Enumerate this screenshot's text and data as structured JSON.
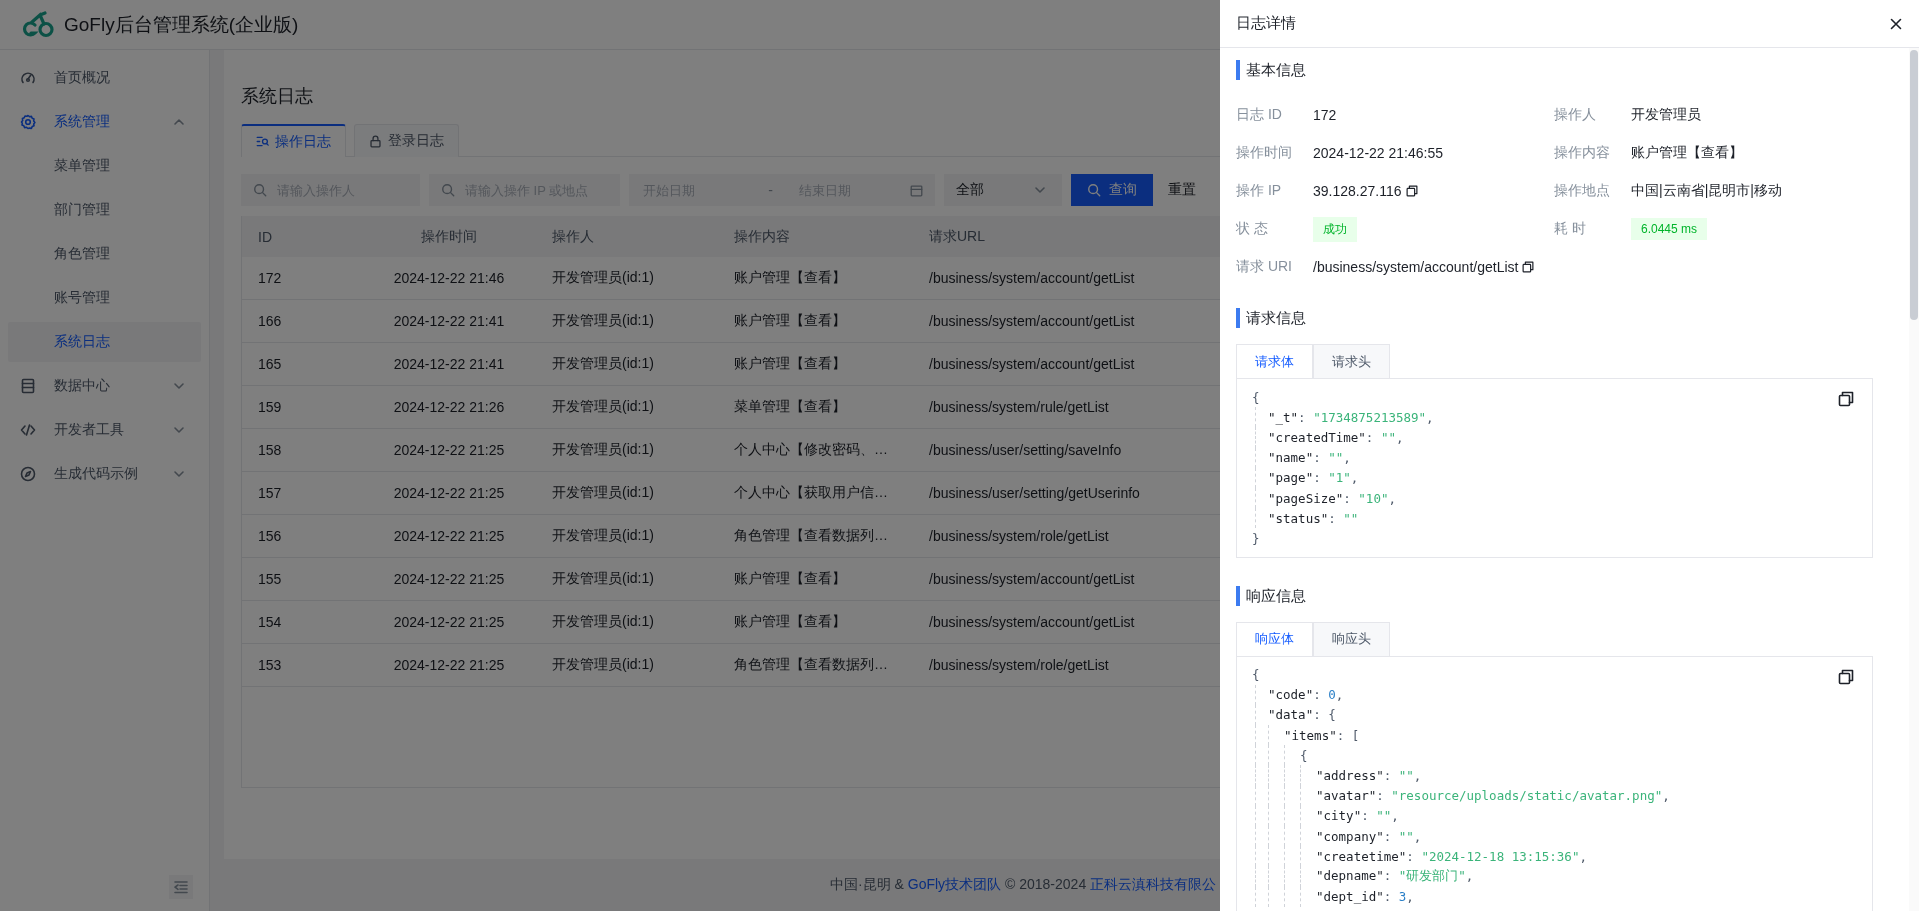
{
  "header": {
    "title": "GoFly后台管理系统(企业版)"
  },
  "sidebar": {
    "items": [
      {
        "label": "首页概况",
        "selected": false
      },
      {
        "label": "系统管理",
        "selected": true,
        "expanded": true,
        "children": [
          {
            "label": "菜单管理",
            "selected": false
          },
          {
            "label": "部门管理",
            "selected": false
          },
          {
            "label": "角色管理",
            "selected": false
          },
          {
            "label": "账号管理",
            "selected": false
          },
          {
            "label": "系统日志",
            "selected": true
          }
        ]
      },
      {
        "label": "数据中心",
        "selected": false,
        "expanded": false
      },
      {
        "label": "开发者工具",
        "selected": false,
        "expanded": false
      },
      {
        "label": "生成代码示例",
        "selected": false,
        "expanded": false
      }
    ]
  },
  "page": {
    "title": "系统日志",
    "tabs": [
      {
        "label": "操作日志",
        "selected": true
      },
      {
        "label": "登录日志",
        "selected": false
      }
    ],
    "filters": [
      {
        "kind": "search",
        "placeholder": "请输入操作人"
      },
      {
        "kind": "search",
        "placeholder": "请输入操作 IP 或地点"
      },
      {
        "kind": "daterange",
        "start_placeholder": "开始日期",
        "separator": "-",
        "end_placeholder": "结束日期"
      },
      {
        "kind": "select",
        "value": "全部"
      }
    ],
    "buttons": [
      {
        "kind": "primary",
        "label": "查询"
      },
      {
        "kind": "plain",
        "label": "重置"
      }
    ],
    "table": {
      "columns": [
        "ID",
        "操作时间",
        "操作人",
        "操作内容",
        "请求URL"
      ],
      "rows": [
        [
          "172",
          "2024-12-22 21:46",
          "开发管理员(id:1)",
          "账户管理【查看】",
          "/business/system/account/getList"
        ],
        [
          "166",
          "2024-12-22 21:41",
          "开发管理员(id:1)",
          "账户管理【查看】",
          "/business/system/account/getList"
        ],
        [
          "165",
          "2024-12-22 21:41",
          "开发管理员(id:1)",
          "账户管理【查看】",
          "/business/system/account/getList"
        ],
        [
          "159",
          "2024-12-22 21:26",
          "开发管理员(id:1)",
          "菜单管理【查看】",
          "/business/system/rule/getList"
        ],
        [
          "158",
          "2024-12-22 21:25",
          "开发管理员(id:1)",
          "个人中心【修改密码、…",
          "/business/user/setting/saveInfo"
        ],
        [
          "157",
          "2024-12-22 21:25",
          "开发管理员(id:1)",
          "个人中心【获取用户信…",
          "/business/user/setting/getUserinfo"
        ],
        [
          "156",
          "2024-12-22 21:25",
          "开发管理员(id:1)",
          "角色管理【查看数据列…",
          "/business/system/role/getList"
        ],
        [
          "155",
          "2024-12-22 21:25",
          "开发管理员(id:1)",
          "账户管理【查看】",
          "/business/system/account/getList"
        ],
        [
          "154",
          "2024-12-22 21:25",
          "开发管理员(id:1)",
          "账户管理【查看】",
          "/business/system/account/getList"
        ],
        [
          "153",
          "2024-12-22 21:25",
          "开发管理员(id:1)",
          "角色管理【查看数据列…",
          "/business/system/role/getList"
        ]
      ]
    },
    "footer": [
      {
        "kind": "text",
        "text": "中国·昆明 &"
      },
      {
        "kind": "link",
        "text": "GoFly技术团队"
      },
      {
        "kind": "text",
        "text": "© 2018-2024"
      },
      {
        "kind": "link",
        "text": "正科云滇科技有限公"
      }
    ]
  },
  "drawer": {
    "title": "日志详情",
    "sections": [
      {
        "title": "基本信息",
        "kind": "fields",
        "fields": [
          {
            "label": "日志 ID",
            "value": "172",
            "kind": "text"
          },
          {
            "label": "操作人",
            "value": "开发管理员",
            "kind": "text"
          },
          {
            "label": "操作时间",
            "value": "2024-12-22 21:46:55",
            "kind": "text"
          },
          {
            "label": "操作内容",
            "value": "账户管理【查看】",
            "kind": "text"
          },
          {
            "label": "操作 IP",
            "value": "39.128.27.116",
            "kind": "copy"
          },
          {
            "label": "操作地点",
            "value": "中国|云南省|昆明市|移动",
            "kind": "text"
          },
          {
            "label": "状 态",
            "value": "成功",
            "kind": "tag"
          },
          {
            "label": "耗 时",
            "value": "6.0445 ms",
            "kind": "tag"
          },
          {
            "label": "请求 URI",
            "value": "/business/system/account/getList",
            "kind": "copy"
          }
        ]
      },
      {
        "title": "请求信息",
        "kind": "code",
        "tabs": [
          {
            "label": "请求体",
            "selected": true
          },
          {
            "label": "请求头",
            "selected": false
          }
        ],
        "lines": [
          {
            "tokens": [
              {
                "kind": "punct",
                "text": "{"
              }
            ],
            "children": [
              {
                "tokens": [
                  {
                    "kind": "key",
                    "text": "\"_t\""
                  },
                  {
                    "kind": "punct",
                    "text": ": "
                  },
                  {
                    "kind": "string",
                    "text": "\"1734875213589\""
                  },
                  {
                    "kind": "punct",
                    "text": ","
                  }
                ]
              },
              {
                "tokens": [
                  {
                    "kind": "key",
                    "text": "\"createdTime\""
                  },
                  {
                    "kind": "punct",
                    "text": ": "
                  },
                  {
                    "kind": "string",
                    "text": "\"\""
                  },
                  {
                    "kind": "punct",
                    "text": ","
                  }
                ]
              },
              {
                "tokens": [
                  {
                    "kind": "key",
                    "text": "\"name\""
                  },
                  {
                    "kind": "punct",
                    "text": ": "
                  },
                  {
                    "kind": "string",
                    "text": "\"\""
                  },
                  {
                    "kind": "punct",
                    "text": ","
                  }
                ]
              },
              {
                "tokens": [
                  {
                    "kind": "key",
                    "text": "\"page\""
                  },
                  {
                    "kind": "punct",
                    "text": ": "
                  },
                  {
                    "kind": "string",
                    "text": "\"1\""
                  },
                  {
                    "kind": "punct",
                    "text": ","
                  }
                ]
              },
              {
                "tokens": [
                  {
                    "kind": "key",
                    "text": "\"pageSize\""
                  },
                  {
                    "kind": "punct",
                    "text": ": "
                  },
                  {
                    "kind": "string",
                    "text": "\"10\""
                  },
                  {
                    "kind": "punct",
                    "text": ","
                  }
                ]
              },
              {
                "tokens": [
                  {
                    "kind": "key",
                    "text": "\"status\""
                  },
                  {
                    "kind": "punct",
                    "text": ": "
                  },
                  {
                    "kind": "string",
                    "text": "\"\""
                  }
                ]
              }
            ]
          },
          {
            "tokens": [
              {
                "kind": "punct",
                "text": "}"
              }
            ]
          }
        ]
      },
      {
        "title": "响应信息",
        "kind": "code",
        "tabs": [
          {
            "label": "响应体",
            "selected": true
          },
          {
            "label": "响应头",
            "selected": false
          }
        ],
        "lines": [
          {
            "tokens": [
              {
                "kind": "punct",
                "text": "{"
              }
            ],
            "children": [
              {
                "tokens": [
                  {
                    "kind": "key",
                    "text": "\"code\""
                  },
                  {
                    "kind": "punct",
                    "text": ": "
                  },
                  {
                    "kind": "number",
                    "text": "0"
                  },
                  {
                    "kind": "punct",
                    "text": ","
                  }
                ]
              },
              {
                "tokens": [
                  {
                    "kind": "key",
                    "text": "\"data\""
                  },
                  {
                    "kind": "punct",
                    "text": ": {"
                  }
                ],
                "children": [
                  {
                    "tokens": [
                      {
                        "kind": "key",
                        "text": "\"items\""
                      },
                      {
                        "kind": "punct",
                        "text": ": ["
                      }
                    ],
                    "children": [
                      {
                        "tokens": [
                          {
                            "kind": "punct",
                            "text": "{"
                          }
                        ],
                        "children": [
                          {
                            "tokens": [
                              {
                                "kind": "key",
                                "text": "\"address\""
                              },
                              {
                                "kind": "punct",
                                "text": ": "
                              },
                              {
                                "kind": "string",
                                "text": "\"\""
                              },
                              {
                                "kind": "punct",
                                "text": ","
                              }
                            ]
                          },
                          {
                            "tokens": [
                              {
                                "kind": "key",
                                "text": "\"avatar\""
                              },
                              {
                                "kind": "punct",
                                "text": ": "
                              },
                              {
                                "kind": "string",
                                "text": "\"resource/uploads/static/avatar.png\""
                              },
                              {
                                "kind": "punct",
                                "text": ","
                              }
                            ]
                          },
                          {
                            "tokens": [
                              {
                                "kind": "key",
                                "text": "\"city\""
                              },
                              {
                                "kind": "punct",
                                "text": ": "
                              },
                              {
                                "kind": "string",
                                "text": "\"\""
                              },
                              {
                                "kind": "punct",
                                "text": ","
                              }
                            ]
                          },
                          {
                            "tokens": [
                              {
                                "kind": "key",
                                "text": "\"company\""
                              },
                              {
                                "kind": "punct",
                                "text": ": "
                              },
                              {
                                "kind": "string",
                                "text": "\"\""
                              },
                              {
                                "kind": "punct",
                                "text": ","
                              }
                            ]
                          },
                          {
                            "tokens": [
                              {
                                "kind": "key",
                                "text": "\"createtime\""
                              },
                              {
                                "kind": "punct",
                                "text": ": "
                              },
                              {
                                "kind": "string",
                                "text": "\"2024-12-18 13:15:36\""
                              },
                              {
                                "kind": "punct",
                                "text": ","
                              }
                            ]
                          },
                          {
                            "tokens": [
                              {
                                "kind": "key",
                                "text": "\"depname\""
                              },
                              {
                                "kind": "punct",
                                "text": ": "
                              },
                              {
                                "kind": "string",
                                "text": "\"研发部门\""
                              },
                              {
                                "kind": "punct",
                                "text": ","
                              }
                            ]
                          },
                          {
                            "tokens": [
                              {
                                "kind": "key",
                                "text": "\"dept_id\""
                              },
                              {
                                "kind": "punct",
                                "text": ": "
                              },
                              {
                                "kind": "number",
                                "text": "3"
                              },
                              {
                                "kind": "punct",
                                "text": ","
                              }
                            ]
                          }
                        ]
                      }
                    ]
                  }
                ]
              }
            ]
          }
        ]
      }
    ]
  }
}
